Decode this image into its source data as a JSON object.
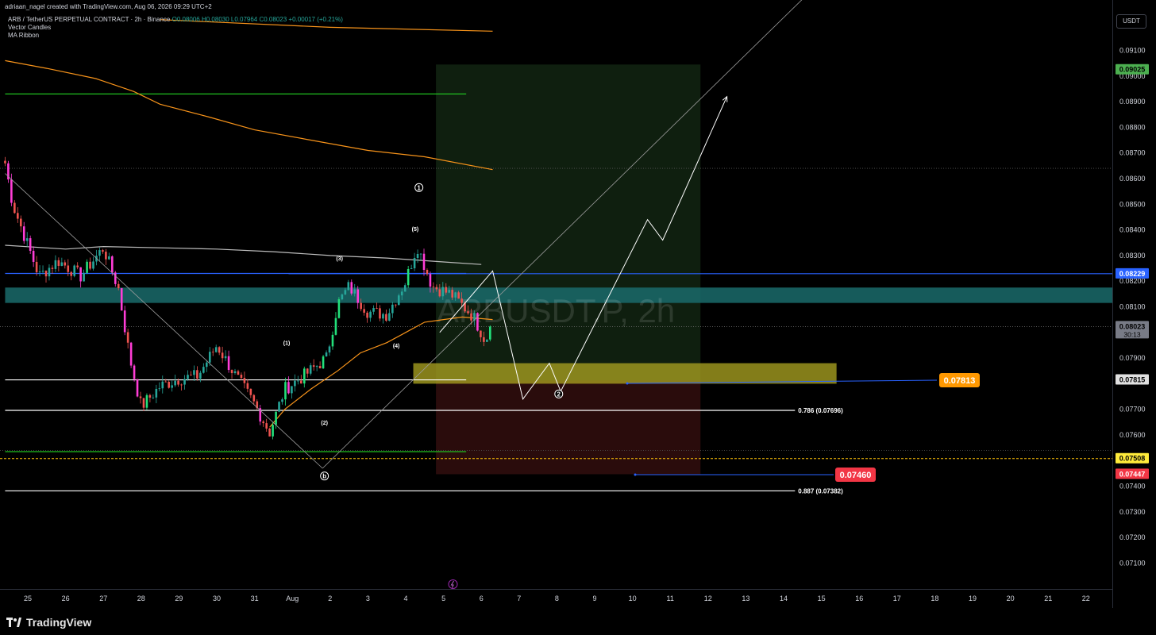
{
  "header": {
    "credit": "adriaan_nagel created with TradingView.com, Aug 06, 2026 09:29 UTC+2"
  },
  "legend": {
    "symbol": "ARB / TetherUS PERPETUAL CONTRACT · 2h · Binance",
    "ohlc": "O0.08006 H0.08030 L0.07964 C0.08023 +0.00017 (+0.21%)",
    "indicators": [
      "Vector Candles",
      "MA Ribbon"
    ]
  },
  "currency": "USDT",
  "watermark": "ARBUSDT.P, 2h",
  "brand": "TradingView",
  "colors": {
    "up": "#26a69a",
    "down": "#ef5350",
    "ma": "#f7931a",
    "green_line": "#20c020",
    "blue_line": "#2962ff",
    "teal_zone": "#1a6b6b",
    "yellow_zone": "#a8a020",
    "target_zone": "#0f1f0f",
    "stop_zone": "#2a0c0c"
  },
  "chart_data": {
    "type": "candlestick",
    "symbol": "ARBUSDT.P",
    "timeframe": "2h",
    "y_axis": {
      "range": [
        0.07,
        0.0925
      ],
      "ticks": [
        "0.09100",
        "0.09000",
        "0.08900",
        "0.08800",
        "0.08700",
        "0.08600",
        "0.08500",
        "0.08400",
        "0.08300",
        "0.08200",
        "0.08100",
        "0.07900",
        "0.07700",
        "0.07600",
        "0.07400",
        "0.07300",
        "0.07200",
        "0.07100"
      ]
    },
    "x_axis": {
      "labels": [
        {
          "label": "25",
          "day": 0
        },
        {
          "label": "26",
          "day": 1
        },
        {
          "label": "27",
          "day": 2
        },
        {
          "label": "28",
          "day": 3
        },
        {
          "label": "29",
          "day": 4
        },
        {
          "label": "30",
          "day": 5
        },
        {
          "label": "31",
          "day": 6
        },
        {
          "label": "Aug",
          "day": 7
        },
        {
          "label": "2",
          "day": 8
        },
        {
          "label": "3",
          "day": 9
        },
        {
          "label": "4",
          "day": 10
        },
        {
          "label": "5",
          "day": 11
        },
        {
          "label": "6",
          "day": 12
        },
        {
          "label": "7",
          "day": 13
        },
        {
          "label": "8",
          "day": 14
        },
        {
          "label": "9",
          "day": 15
        },
        {
          "label": "10",
          "day": 16
        },
        {
          "label": "11",
          "day": 17
        },
        {
          "label": "12",
          "day": 18
        },
        {
          "label": "13",
          "day": 19
        },
        {
          "label": "14",
          "day": 20
        },
        {
          "label": "15",
          "day": 21
        },
        {
          "label": "16",
          "day": 22
        },
        {
          "label": "17",
          "day": 23
        },
        {
          "label": "18",
          "day": 24
        },
        {
          "label": "19",
          "day": 25
        },
        {
          "label": "20",
          "day": 26
        },
        {
          "label": "21",
          "day": 27
        },
        {
          "label": "22",
          "day": 28
        }
      ]
    },
    "price_tags": [
      {
        "value": "0.09025",
        "price": 0.09025,
        "bg": "#4caf50",
        "fg": "#000000"
      },
      {
        "value": "0.08229",
        "price": 0.08229,
        "bg": "#2962ff",
        "fg": "#ffffff"
      },
      {
        "value": "0.08023",
        "sub": "30:13",
        "price": 0.08023,
        "bg": "#787b86",
        "fg": "#000000"
      },
      {
        "value": "0.07815",
        "price": 0.07815,
        "bg": "#e0e0e0",
        "fg": "#000000"
      },
      {
        "value": "0.07508",
        "price": 0.07508,
        "bg": "#ffeb3b",
        "fg": "#000000"
      },
      {
        "value": "0.07447",
        "price": 0.07447,
        "bg": "#f23645",
        "fg": "#ffffff"
      }
    ],
    "callouts": [
      {
        "label": "0.07813",
        "price": 0.07813,
        "day": 16.1,
        "bg": "#ff9800"
      },
      {
        "label": "0.07460",
        "price": 0.0746,
        "day": 13.5,
        "bg": "#f23645"
      }
    ],
    "fib_levels": [
      {
        "label": "0.786 (0.07696)",
        "price": 0.07696
      },
      {
        "label": "0.887 (0.07382)",
        "price": 0.07382
      }
    ],
    "horizontal_lines": [
      {
        "price": 0.0893,
        "day_from": -0.6,
        "day_to": 11.6,
        "color": "#20c020"
      },
      {
        "price": 0.0823,
        "day_from": -0.6,
        "day_to": 11.6,
        "color": "#2962ff"
      },
      {
        "price": 0.07815,
        "day_from": -0.6,
        "day_to": 11.6,
        "color": "#ffffff"
      },
      {
        "price": 0.07696,
        "day_from": -0.6,
        "day_to": 20.3,
        "color": "#ffffff"
      },
      {
        "price": 0.07535,
        "day_from": -0.6,
        "day_to": 11.6,
        "color": "#20c020"
      },
      {
        "price": 0.07382,
        "day_from": -0.6,
        "day_to": 20.3,
        "color": "#ffffff"
      },
      {
        "price": 0.08229,
        "day_from": 6.9,
        "day_to": 28.9,
        "color": "#2962ff"
      }
    ],
    "zones": [
      {
        "name": "resistance",
        "price_top": 0.08175,
        "price_bottom": 0.08115,
        "day_from": -0.6,
        "day_to": 28.9
      },
      {
        "name": "entry",
        "price_top": 0.0788,
        "price_bottom": 0.078,
        "day_from": 10.2,
        "day_to": 21.4
      },
      {
        "name": "target",
        "price_top": 0.09045,
        "price_bottom": 0.07813,
        "day_from": 10.8,
        "day_to": 17.8
      },
      {
        "name": "stop",
        "price_top": 0.07813,
        "price_bottom": 0.07447,
        "day_from": 10.8,
        "day_to": 17.8
      }
    ],
    "wave_labels": [
      {
        "label": "1",
        "day": 10.35,
        "price": 0.08565,
        "circled": true
      },
      {
        "label": "(5)",
        "day": 10.25,
        "price": 0.08405,
        "circled": false
      },
      {
        "label": "(3)",
        "day": 8.25,
        "price": 0.0829,
        "circled": false
      },
      {
        "label": "(1)",
        "day": 6.85,
        "price": 0.0796,
        "circled": false
      },
      {
        "label": "(4)",
        "day": 9.75,
        "price": 0.0795,
        "circled": false
      },
      {
        "label": "(2)",
        "day": 7.85,
        "price": 0.0765,
        "circled": false
      },
      {
        "label": "b",
        "day": 7.85,
        "price": 0.0744,
        "circled": true
      },
      {
        "label": "2",
        "day": 14.05,
        "price": 0.0776,
        "circled": true
      }
    ],
    "projection_path": [
      {
        "day": 10.9,
        "price": 0.08
      },
      {
        "day": 12.3,
        "price": 0.0824
      },
      {
        "day": 13.1,
        "price": 0.0774
      },
      {
        "day": 13.8,
        "price": 0.0788
      },
      {
        "day": 14.1,
        "price": 0.0777
      },
      {
        "day": 16.4,
        "price": 0.0844
      },
      {
        "day": 16.8,
        "price": 0.0836
      },
      {
        "day": 18.5,
        "price": 0.0892
      }
    ],
    "trend_lines": [
      {
        "from": {
          "day": -0.6,
          "price": 0.0862
        },
        "to": {
          "day": 7.8,
          "price": 0.0747
        }
      },
      {
        "from": {
          "day": 7.8,
          "price": 0.0747
        },
        "to": {
          "day": 20.5,
          "price": 0.093
        }
      }
    ],
    "moving_averages": [
      {
        "points": [
          {
            "day": 3.5,
            "price": 0.0922
          },
          {
            "day": 8.0,
            "price": 0.0919
          },
          {
            "day": 12.3,
            "price": 0.09175
          }
        ]
      },
      {
        "points": [
          {
            "day": -0.6,
            "price": 0.0906
          },
          {
            "day": 0.5,
            "price": 0.0903
          },
          {
            "day": 1.8,
            "price": 0.0899
          },
          {
            "day": 2.8,
            "price": 0.0894
          },
          {
            "day": 3.5,
            "price": 0.0889
          },
          {
            "day": 4.8,
            "price": 0.0884
          },
          {
            "day": 6.0,
            "price": 0.0879
          },
          {
            "day": 7.5,
            "price": 0.0875
          },
          {
            "day": 9.0,
            "price": 0.0871
          },
          {
            "day": 10.5,
            "price": 0.08685
          },
          {
            "day": 12.3,
            "price": 0.08635
          }
        ]
      },
      {
        "points": [
          {
            "day": 6.4,
            "price": 0.0763
          },
          {
            "day": 6.8,
            "price": 0.077
          },
          {
            "day": 7.5,
            "price": 0.0778
          },
          {
            "day": 8.2,
            "price": 0.0785
          },
          {
            "day": 8.8,
            "price": 0.0792
          },
          {
            "day": 9.5,
            "price": 0.0796
          },
          {
            "day": 10.0,
            "price": 0.08
          },
          {
            "day": 10.5,
            "price": 0.0804
          },
          {
            "day": 11.0,
            "price": 0.0805
          },
          {
            "day": 11.5,
            "price": 0.0806
          },
          {
            "day": 12.3,
            "price": 0.0805
          }
        ]
      },
      {
        "points": [
          {
            "day": -0.6,
            "price": 0.0834
          },
          {
            "day": 1.0,
            "price": 0.08325
          },
          {
            "day": 2.0,
            "price": 0.08335
          },
          {
            "day": 3.5,
            "price": 0.0833
          },
          {
            "day": 5.0,
            "price": 0.08325
          },
          {
            "day": 6.5,
            "price": 0.08315
          },
          {
            "day": 8.0,
            "price": 0.083
          },
          {
            "day": 9.5,
            "price": 0.0829
          },
          {
            "day": 11.0,
            "price": 0.08275
          },
          {
            "day": 12.0,
            "price": 0.08265
          }
        ]
      }
    ],
    "last_price": 0.08023,
    "price_keypoints": [
      {
        "day": -0.6,
        "price": 0.0866
      },
      {
        "day": -0.4,
        "price": 0.085
      },
      {
        "day": -0.1,
        "price": 0.0838
      },
      {
        "day": 0.3,
        "price": 0.0822
      },
      {
        "day": 0.8,
        "price": 0.0828
      },
      {
        "day": 1.4,
        "price": 0.0822
      },
      {
        "day": 2.0,
        "price": 0.0833
      },
      {
        "day": 2.4,
        "price": 0.0817
      },
      {
        "day": 2.7,
        "price": 0.079
      },
      {
        "day": 3.0,
        "price": 0.0771
      },
      {
        "day": 3.5,
        "price": 0.0779
      },
      {
        "day": 4.0,
        "price": 0.0782
      },
      {
        "day": 4.5,
        "price": 0.0783
      },
      {
        "day": 5.0,
        "price": 0.0795
      },
      {
        "day": 5.5,
        "price": 0.0783
      },
      {
        "day": 6.0,
        "price": 0.0772
      },
      {
        "day": 6.4,
        "price": 0.0761
      },
      {
        "day": 6.8,
        "price": 0.0778
      },
      {
        "day": 7.3,
        "price": 0.0783
      },
      {
        "day": 7.9,
        "price": 0.079
      },
      {
        "day": 8.2,
        "price": 0.0811
      },
      {
        "day": 8.5,
        "price": 0.0818
      },
      {
        "day": 9.0,
        "price": 0.0808
      },
      {
        "day": 9.5,
        "price": 0.0807
      },
      {
        "day": 10.0,
        "price": 0.082
      },
      {
        "day": 10.3,
        "price": 0.0834
      },
      {
        "day": 10.7,
        "price": 0.0818
      },
      {
        "day": 11.2,
        "price": 0.0815
      },
      {
        "day": 11.8,
        "price": 0.0806
      },
      {
        "day": 12.1,
        "price": 0.0797
      },
      {
        "day": 12.3,
        "price": 0.08023
      }
    ]
  }
}
